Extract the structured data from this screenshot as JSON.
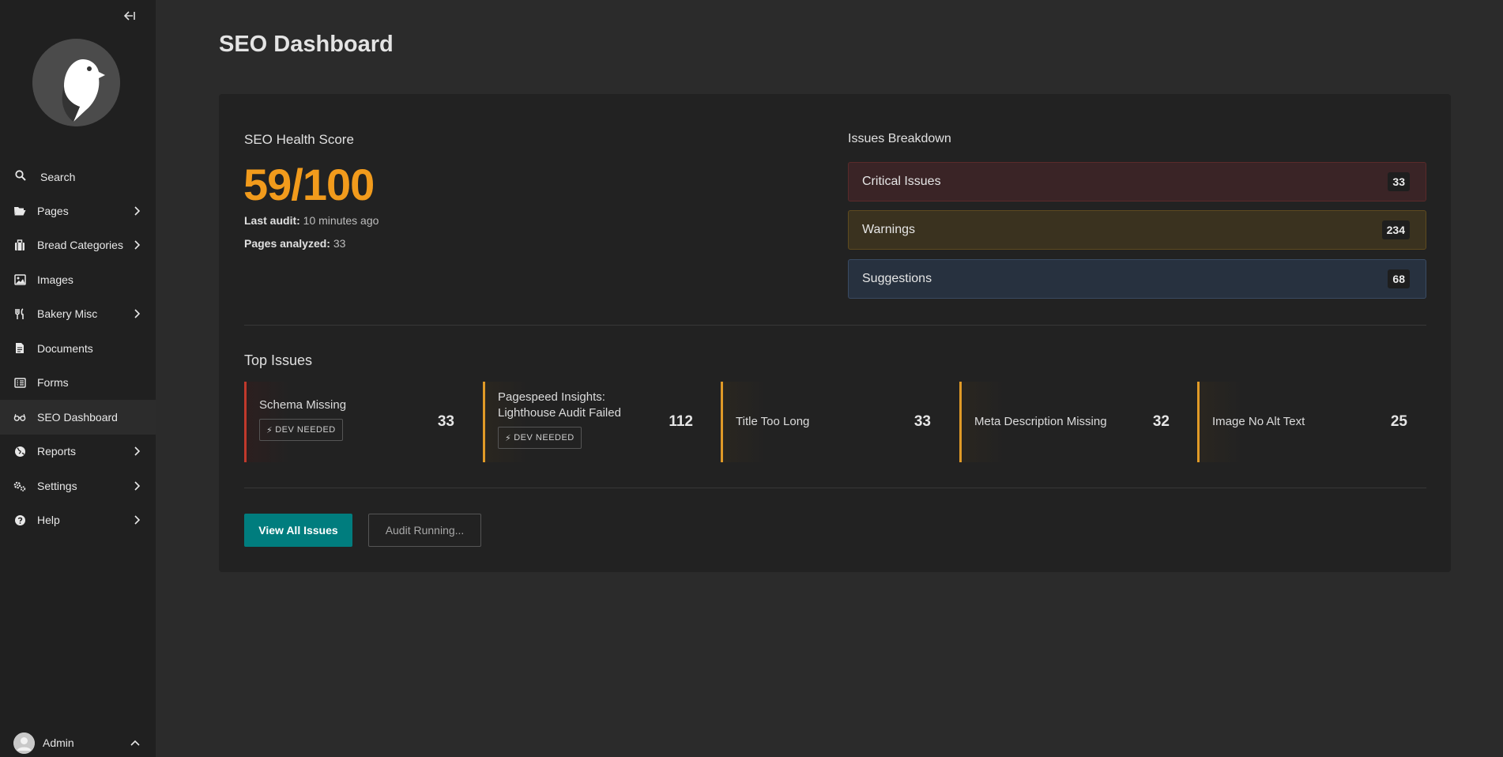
{
  "sidebar": {
    "collapse_icon": "collapse-sidebar-icon",
    "search_label": "Search",
    "items": [
      {
        "label": "Pages",
        "icon": "folder-open-icon",
        "has_children": true
      },
      {
        "label": "Bread Categories",
        "icon": "suitcase-icon",
        "has_children": true
      },
      {
        "label": "Images",
        "icon": "image-icon",
        "has_children": false
      },
      {
        "label": "Bakery Misc",
        "icon": "utensils-icon",
        "has_children": true
      },
      {
        "label": "Documents",
        "icon": "document-icon",
        "has_children": false
      },
      {
        "label": "Forms",
        "icon": "form-list-icon",
        "has_children": false
      },
      {
        "label": "SEO Dashboard",
        "icon": "glasses-icon",
        "has_children": false,
        "active": true
      },
      {
        "label": "Reports",
        "icon": "globe-icon",
        "has_children": true
      },
      {
        "label": "Settings",
        "icon": "cogs-icon",
        "has_children": true
      },
      {
        "label": "Help",
        "icon": "help-icon",
        "has_children": true
      }
    ],
    "user": {
      "name": "Admin",
      "icon": "chevron-up-icon"
    }
  },
  "page": {
    "title": "SEO Dashboard"
  },
  "health": {
    "heading": "SEO Health Score",
    "score": "59/100",
    "last_audit_label": "Last audit:",
    "last_audit_value": "10 minutes ago",
    "pages_label": "Pages analyzed:",
    "pages_value": "33",
    "score_color": "#f29b1c"
  },
  "breakdown": {
    "heading": "Issues Breakdown",
    "rows": [
      {
        "label": "Critical Issues",
        "count": "33"
      },
      {
        "label": "Warnings",
        "count": "234"
      },
      {
        "label": "Suggestions",
        "count": "68"
      }
    ]
  },
  "top_issues": {
    "heading": "Top Issues",
    "items": [
      {
        "name": "Schema Missing",
        "count": "33",
        "tag": "DEV NEEDED",
        "severity": "critical"
      },
      {
        "name": "Pagespeed Insights: Lighthouse Audit Failed",
        "count": "112",
        "tag": "DEV NEEDED",
        "severity": "warning"
      },
      {
        "name": "Title Too Long",
        "count": "33",
        "severity": "warning"
      },
      {
        "name": "Meta Description Missing",
        "count": "32",
        "severity": "warning"
      },
      {
        "name": "Image No Alt Text",
        "count": "25",
        "severity": "warning"
      }
    ]
  },
  "actions": {
    "view_all": "View All Issues",
    "audit": "Audit Running...",
    "primary_color": "#007d7e"
  }
}
